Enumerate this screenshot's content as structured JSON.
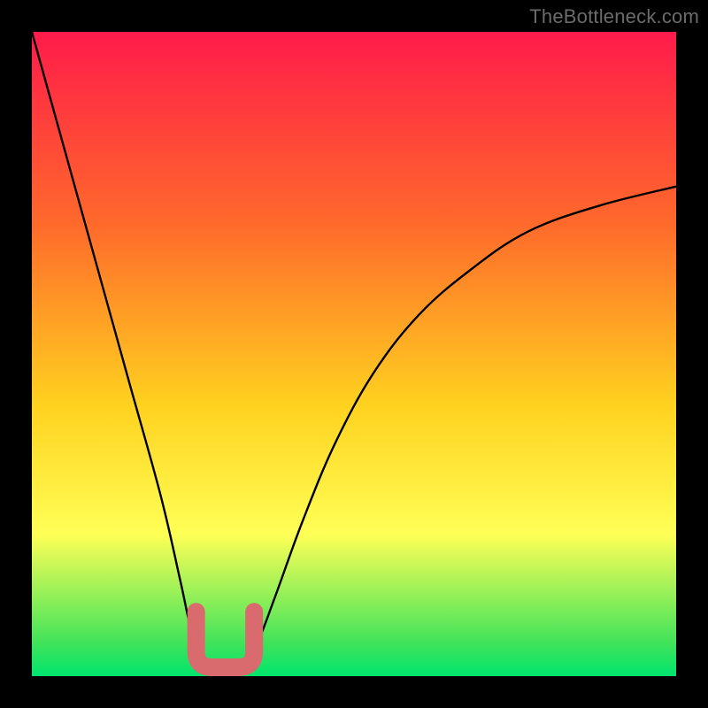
{
  "watermark": "TheBottleneck.com",
  "colors": {
    "frame": "#000000",
    "gradient_top": "#ff1b4a",
    "gradient_mid_upper": "#ff6a2b",
    "gradient_mid": "#ffd21f",
    "gradient_mid_lower": "#ffff56",
    "gradient_green": "#3fe35a",
    "gradient_bottom": "#00e46e",
    "curve": "#000000",
    "marker": "#d96a6d"
  },
  "chart_data": {
    "type": "line",
    "title": "",
    "xlabel": "",
    "ylabel": "",
    "xlim": [
      0,
      100
    ],
    "ylim": [
      0,
      100
    ],
    "series": [
      {
        "name": "bottleneck-curve",
        "x": [
          0,
          5,
          10,
          15,
          20,
          23,
          25,
          27,
          29,
          31,
          33,
          35,
          38,
          42,
          47,
          53,
          60,
          68,
          77,
          88,
          100
        ],
        "y": [
          100,
          82,
          64,
          46,
          28,
          15,
          6,
          1,
          0,
          0,
          1,
          5,
          13,
          24,
          36,
          47,
          56,
          63,
          69,
          73,
          76
        ]
      }
    ],
    "annotations": [
      {
        "name": "min-region-marker",
        "x_range": [
          25.5,
          34.5
        ],
        "y_max": 10,
        "style": "thick-u-shape",
        "color": "#d96a6d"
      }
    ]
  }
}
